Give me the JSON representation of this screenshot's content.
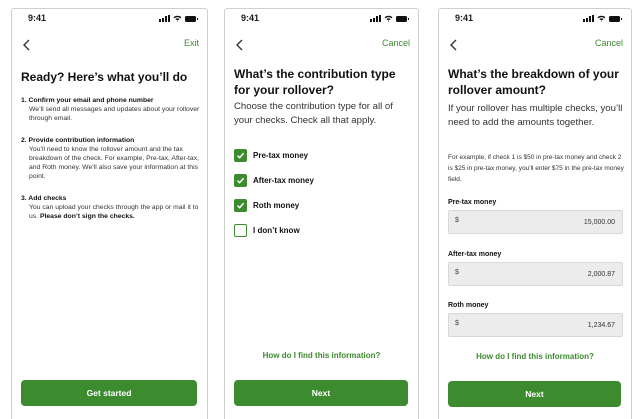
{
  "status": {
    "time": "9:41"
  },
  "screen1": {
    "nav_action": "Exit",
    "title": "Ready? Here’s what you’ll do",
    "steps": [
      {
        "title": "1. Confirm your email and phone number",
        "desc": "We’ll send all messages and updates about your rollover through email."
      },
      {
        "title": "2. Provide contribution information",
        "desc": "You’ll need to know the rollover amount and the tax breakdown of the check. For example, Pre-tax, After-tax, and Roth money. We’ll also save your information at this point."
      },
      {
        "title": "3. Add checks",
        "desc": "You can upload your checks through the app or mail it to us.",
        "desc_bold": "Please don’t sign the checks."
      }
    ],
    "button": "Get started"
  },
  "screen2": {
    "nav_action": "Cancel",
    "title": "What’s the contribution type for your rollover?",
    "subtitle": "Choose the contribution type for all of your checks. Check all that apply.",
    "options": [
      {
        "label": "Pre-tax money",
        "checked": true
      },
      {
        "label": "After-tax money",
        "checked": true
      },
      {
        "label": "Roth money",
        "checked": true
      },
      {
        "label": "I don’t know",
        "checked": false
      }
    ],
    "help_link": "How do I find this information?",
    "button": "Next"
  },
  "screen3": {
    "nav_action": "Cancel",
    "title": "What’s the breakdown of your rollover amount?",
    "subtitle": "If your rollover has multiple checks, you’ll need to add the amounts together.",
    "example": "For example, if check 1 is $50 in pre-tax money and check 2 is $25 in pre-tax money, you’ll enter $75 in the pre-tax money field.",
    "fields": [
      {
        "label": "Pre-tax money",
        "currency": "$",
        "value": "15,000.00"
      },
      {
        "label": "After-tax money",
        "currency": "$",
        "value": "2,000.87"
      },
      {
        "label": "Roth money",
        "currency": "$",
        "value": "1,234.67"
      }
    ],
    "help_link": "How do I find this information?",
    "button": "Next"
  },
  "colors": {
    "accent": "#3d8b2f",
    "field_bg": "#ececec"
  },
  "icons": [
    "chevron-left-icon",
    "signal-icon",
    "wifi-icon",
    "battery-icon",
    "checkmark-icon"
  ]
}
